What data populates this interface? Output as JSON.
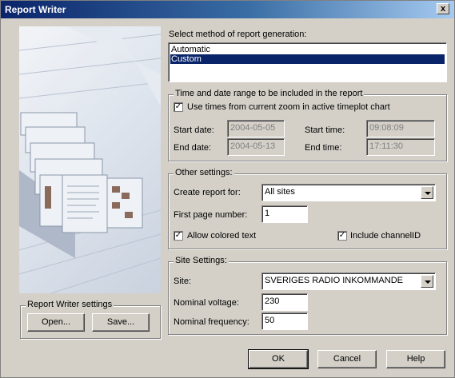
{
  "window": {
    "title": "Report Writer",
    "close_label": "x"
  },
  "method": {
    "label": "Select method of report generation:",
    "options": [
      "Automatic",
      "Custom"
    ],
    "selected": "Custom"
  },
  "time_range": {
    "title": "Time and date range to be included in the report",
    "use_times_label": "Use times from current zoom in active timeplot chart",
    "use_times_checked": true,
    "start_date_label": "Start date:",
    "start_date": "2004-05-05",
    "end_date_label": "End date:",
    "end_date": "2004-05-13",
    "start_time_label": "Start time:",
    "start_time": "09:08:09",
    "end_time_label": "End time:",
    "end_time": "17:11:30"
  },
  "other": {
    "title": "Other settings:",
    "create_for_label": "Create report for:",
    "create_for_value": "All sites",
    "first_page_label": "First page number:",
    "first_page_value": "1",
    "allow_colored_label": "Allow colored text",
    "allow_colored_checked": true,
    "include_channel_label": "Include channelID",
    "include_channel_checked": true
  },
  "site": {
    "title": "Site Settings:",
    "site_label": "Site:",
    "site_value": "SVERIGES RADIO INKOMMANDE",
    "voltage_label": "Nominal voltage:",
    "voltage_value": "230",
    "frequency_label": "Nominal frequency:",
    "frequency_value": "50"
  },
  "writer_settings": {
    "title": "Report Writer settings",
    "open_label": "Open...",
    "save_label": "Save..."
  },
  "footer": {
    "ok_label": "OK",
    "cancel_label": "Cancel",
    "help_label": "Help"
  },
  "check_glyph": "✓"
}
